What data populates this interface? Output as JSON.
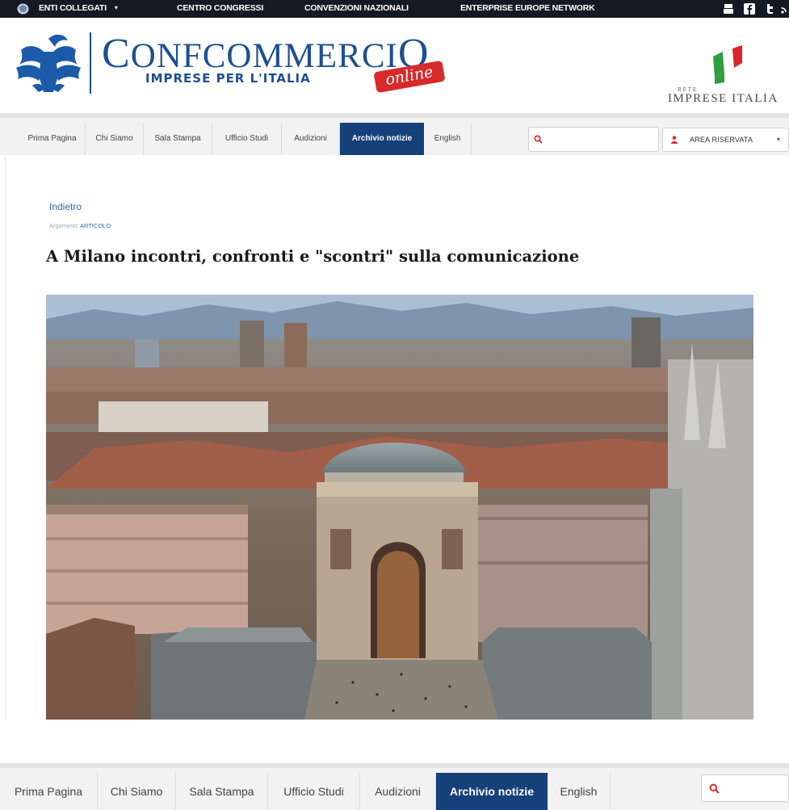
{
  "topbar": {
    "enti": "ENTI COLLEGATI",
    "enti_caret": "▾",
    "centro": "CENTRO CONGRESSI",
    "convenzioni": "CONVENZIONI NAZIONALI",
    "een": "ENTERPRISE EUROPE NETWORK",
    "social_icons": [
      "youtube-icon",
      "facebook-icon",
      "twitter-icon",
      "rss-icon"
    ]
  },
  "header": {
    "brand_first": "C",
    "brand_rest": "ONFCOMMERCI",
    "brand_last": "O",
    "brand_sub": "IMPRESE PER L'ITALIA",
    "online": "online",
    "rete": "RETE",
    "partner": "IMPRESE ITALIA"
  },
  "nav": {
    "items": [
      "Prima Pagina",
      "Chi Siamo",
      "Sala Stampa",
      "Ufficio Studi",
      "Audizioni",
      "Archivio notizie",
      "English"
    ],
    "active": "Archivio notizie",
    "area_riservata": "AREA RISERVATA",
    "search_value": ""
  },
  "article": {
    "back": "Indietro",
    "tag_label": "Argomenti:",
    "tag_value": "ARTICOLO",
    "title": "A Milano incontri, confronti e \"scontri\" sulla comunicazione"
  },
  "colors": {
    "nav_active": "#15407a",
    "brand_blue": "#1d4f91",
    "accent_red": "#d82a2a",
    "topbar": "#141a24"
  }
}
